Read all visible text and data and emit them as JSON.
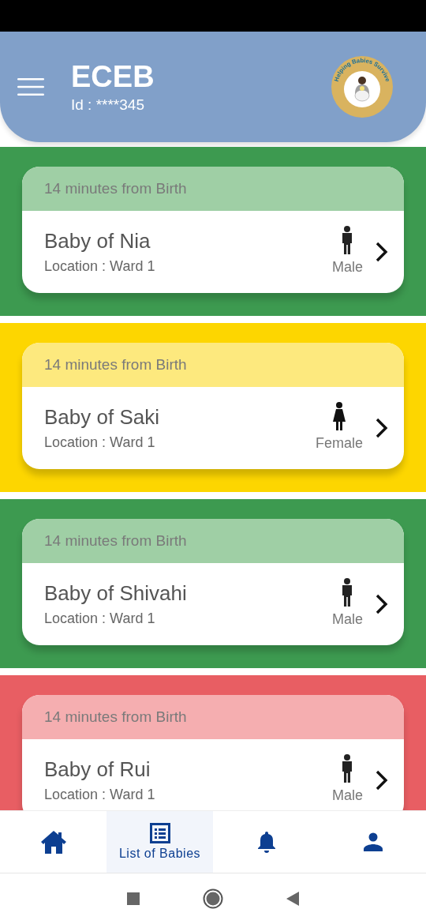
{
  "header": {
    "title": "ECEB",
    "id_text": "Id : ****345",
    "logo_text": "Helping Babies Survive"
  },
  "babies": [
    {
      "time": "14 minutes from Birth",
      "name": "Baby of Nia",
      "location": "Location : Ward 1",
      "kind": "male",
      "gender": "Male",
      "color": "#3d9a50"
    },
    {
      "time": "14 minutes from Birth",
      "name": "Baby of Saki",
      "location": "Location : Ward 1",
      "kind": "female",
      "gender": "Female",
      "color": "#fdd600"
    },
    {
      "time": "14 minutes from Birth",
      "name": "Baby of Shivahi",
      "location": "Location : Ward 1",
      "kind": "male",
      "gender": "Male",
      "color": "#3d9a50"
    },
    {
      "time": "14 minutes from Birth",
      "name": "Baby of Rui",
      "location": "Location : Ward 1",
      "kind": "male",
      "gender": "Male",
      "color": "#e85e63"
    }
  ],
  "bottom_nav": [
    {
      "kind": "home",
      "selected": false
    },
    {
      "kind": "list",
      "label": "List of Babies",
      "selected": true
    },
    {
      "kind": "bell",
      "selected": false
    },
    {
      "kind": "person",
      "selected": false
    }
  ]
}
